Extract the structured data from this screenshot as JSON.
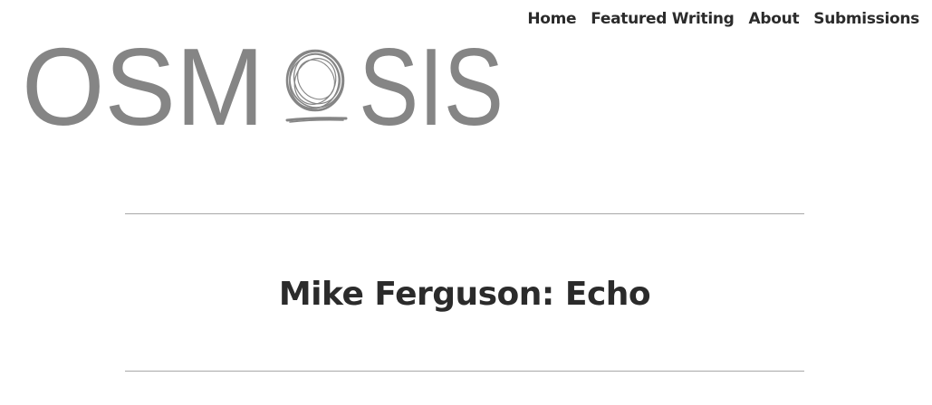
{
  "nav": {
    "items": [
      {
        "label": "Home"
      },
      {
        "label": "Featured Writing"
      },
      {
        "label": "About"
      },
      {
        "label": "Submissions"
      }
    ]
  },
  "logo": {
    "text_left": "OSM",
    "text_right": "SIS",
    "scribble_icon": "scribbled-o-icon",
    "color": "#858585"
  },
  "post": {
    "title": "Mike Ferguson: Echo"
  },
  "colors": {
    "text": "#2b2b2b",
    "rule": "#a8a8a8",
    "background": "#ffffff"
  }
}
